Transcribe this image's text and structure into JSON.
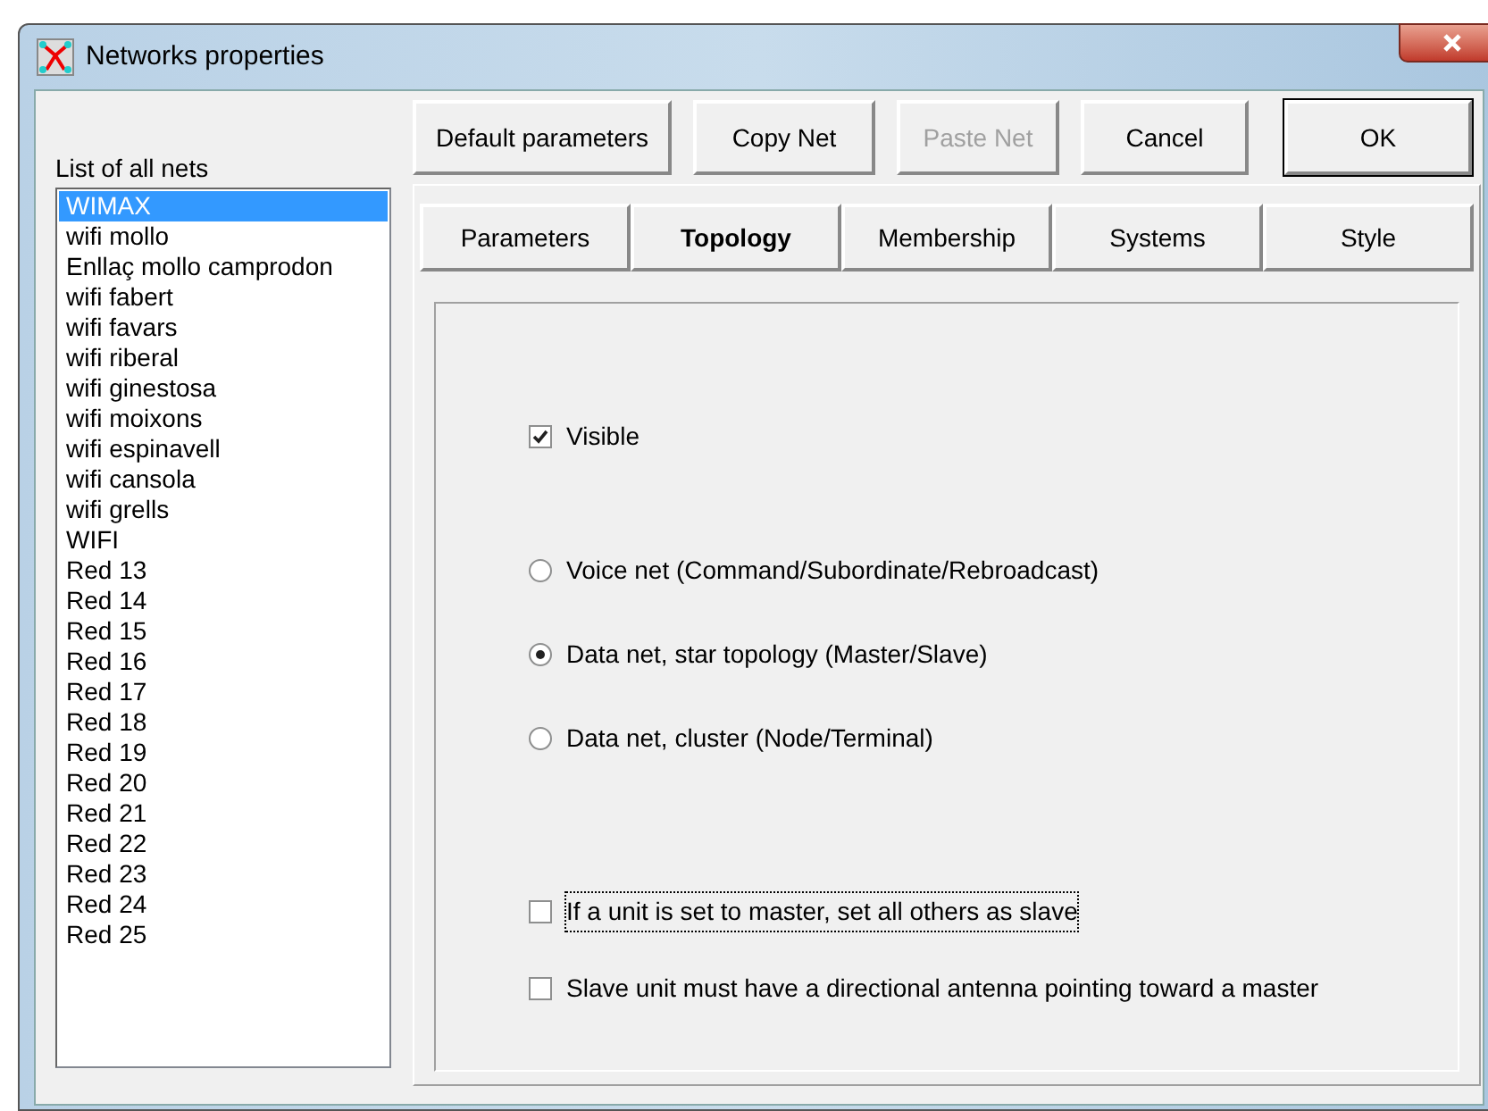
{
  "window": {
    "title": "Networks properties"
  },
  "list_label": "List of all nets",
  "nets": [
    {
      "name": "WIMAX",
      "selected": true
    },
    {
      "name": "wifi mollo",
      "selected": false
    },
    {
      "name": "Enllaç mollo camprodon",
      "selected": false
    },
    {
      "name": "wifi fabert",
      "selected": false
    },
    {
      "name": "wifi favars",
      "selected": false
    },
    {
      "name": "wifi riberal",
      "selected": false
    },
    {
      "name": "wifi ginestosa",
      "selected": false
    },
    {
      "name": "wifi moixons",
      "selected": false
    },
    {
      "name": "wifi espinavell",
      "selected": false
    },
    {
      "name": "wifi cansola",
      "selected": false
    },
    {
      "name": "wifi grells",
      "selected": false
    },
    {
      "name": "WIFI",
      "selected": false
    },
    {
      "name": "Red 13",
      "selected": false
    },
    {
      "name": "Red 14",
      "selected": false
    },
    {
      "name": "Red 15",
      "selected": false
    },
    {
      "name": "Red 16",
      "selected": false
    },
    {
      "name": "Red 17",
      "selected": false
    },
    {
      "name": "Red 18",
      "selected": false
    },
    {
      "name": "Red 19",
      "selected": false
    },
    {
      "name": "Red 20",
      "selected": false
    },
    {
      "name": "Red 21",
      "selected": false
    },
    {
      "name": "Red 22",
      "selected": false
    },
    {
      "name": "Red 23",
      "selected": false
    },
    {
      "name": "Red 24",
      "selected": false
    },
    {
      "name": "Red 25",
      "selected": false
    }
  ],
  "buttons": [
    {
      "label": "Default parameters",
      "disabled": false,
      "default": false
    },
    {
      "label": "Copy Net",
      "disabled": false,
      "default": false
    },
    {
      "label": "Paste Net",
      "disabled": true,
      "default": false
    },
    {
      "label": "Cancel",
      "disabled": false,
      "default": false
    },
    {
      "label": "OK",
      "disabled": false,
      "default": true
    }
  ],
  "tabs": [
    {
      "label": "Parameters",
      "selected": false
    },
    {
      "label": "Topology",
      "selected": true
    },
    {
      "label": "Membership",
      "selected": false
    },
    {
      "label": "Systems",
      "selected": false
    },
    {
      "label": "Style",
      "selected": false
    }
  ],
  "options": [
    {
      "kind": "checkbox",
      "label": "Visible",
      "checked": true,
      "focused": false
    },
    {
      "kind": "radio",
      "label": "Voice net (Command/Subordinate/Rebroadcast)",
      "selected": false
    },
    {
      "kind": "radio",
      "label": "Data net, star topology (Master/Slave)",
      "selected": true
    },
    {
      "kind": "radio",
      "label": "Data net, cluster (Node/Terminal)",
      "selected": false
    },
    {
      "kind": "checkbox",
      "label": "If a unit is set to master, set all others as slave",
      "checked": false,
      "focused": true
    },
    {
      "kind": "checkbox",
      "label": "Slave unit must have a directional antenna pointing toward a master",
      "checked": false,
      "focused": false
    }
  ]
}
